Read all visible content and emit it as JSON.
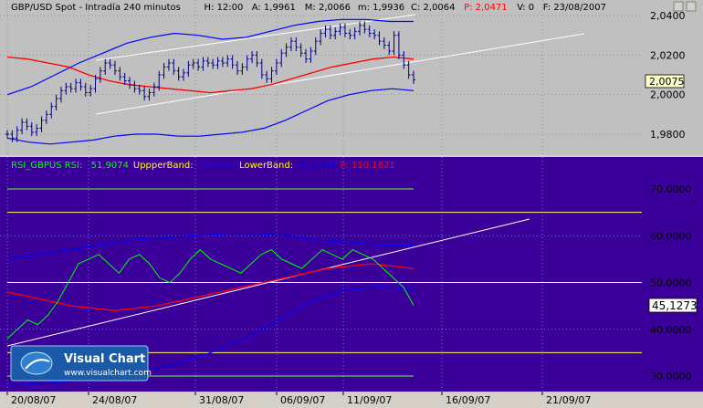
{
  "top_panel": {
    "header": [
      {
        "text": "GBP/USD Spot - Intradía 240 minutos",
        "color": "#000000"
      },
      {
        "text": "H: 12:00",
        "color": "#000000"
      },
      {
        "text": "A: 1,9961",
        "color": "#000000"
      },
      {
        "text": "M: 2,0066",
        "color": "#000000"
      },
      {
        "text": "m: 1,9936",
        "color": "#000000"
      },
      {
        "text": "C: 2,0064",
        "color": "#000000"
      },
      {
        "text": "P: 2,0471",
        "color": "#ff0000"
      },
      {
        "text": "V: 0",
        "color": "#000000"
      },
      {
        "text": "F: 23/08/2007",
        "color": "#000000"
      }
    ],
    "y_ticks": [
      "2,0400",
      "2,0200",
      "2,0000",
      "1,9800"
    ],
    "last_value_label": "2,0075",
    "colors": {
      "background": "#c0c0c0",
      "price_bars": "#000080",
      "moving_average": "#ff0000",
      "bands": "#0000ff",
      "trendlines": "#ffffff"
    }
  },
  "bottom_panel": {
    "header": [
      {
        "text": "RSI_GBPUS RSI:",
        "color": "#00ff00"
      },
      {
        "text": "51,9074",
        "color": "#00ff00"
      },
      {
        "text": "UppperBand:",
        "color": "#ffff00"
      },
      {
        "text": "70,0000",
        "color": "#0000ff"
      },
      {
        "text": "LowerBand:",
        "color": "#ffff00"
      },
      {
        "text": "30,0000",
        "color": "#0000ff"
      },
      {
        "text": "P: 110,1821",
        "color": "#ff0000"
      }
    ],
    "y_ticks": [
      "70,0000",
      "60,0000",
      "50,0000",
      "40,0000",
      "30,0000"
    ],
    "last_value_label": "45,1273",
    "colors": {
      "background": "#3a0099",
      "rsi": "#00ff00",
      "moving_average": "#ff0000",
      "bands": "#0000ff",
      "levels_green": "#66ff33",
      "levels_yellow": "#ffff66",
      "trendline": "#ffffff"
    }
  },
  "x_axis": {
    "labels": [
      "20/08/07",
      "24/08/07",
      "31/08/07",
      "06/09/07",
      "11/09/07",
      "16/09/07",
      "21/09/07"
    ]
  },
  "logo": {
    "name": "Visual Chart",
    "url": "www.visualchart.com"
  },
  "chart_data": [
    {
      "type": "candlestick",
      "title": "GBP/USD Spot - Intradía 240 minutos",
      "ylim": [
        1.97,
        2.042
      ],
      "series": [
        {
          "name": "GBP/USD",
          "values": [
            1.98,
            1.978,
            1.982,
            1.986,
            1.984,
            1.981,
            1.983,
            1.987,
            1.99,
            1.994,
            1.998,
            2.002,
            2.004,
            2.003,
            2.006,
            2.004,
            2.001,
            2.003,
            2.008,
            2.012,
            2.016,
            2.015,
            2.012,
            2.009,
            2.007,
            2.005,
            2.003,
            2.002,
            1.999,
            2.001,
            2.004,
            2.01,
            2.014,
            2.016,
            2.012,
            2.009,
            2.011,
            2.015,
            2.016,
            2.014,
            2.017,
            2.016,
            2.015,
            2.017,
            2.016,
            2.018,
            2.015,
            2.012,
            2.014,
            2.018,
            2.02,
            2.016,
            2.01,
            2.008,
            2.012,
            2.016,
            2.021,
            2.024,
            2.027,
            2.024,
            2.021,
            2.018,
            2.022,
            2.027,
            2.031,
            2.033,
            2.03,
            2.032,
            2.034,
            2.031,
            2.03,
            2.032,
            2.035,
            2.033,
            2.031,
            2.03,
            2.027,
            2.025,
            2.022,
            2.03,
            2.02,
            2.015,
            2.01,
            2.0075
          ]
        },
        {
          "name": "Moving average",
          "values": [
            2.019,
            2.018,
            2.016,
            2.014,
            2.01,
            2.007,
            2.005,
            2.004,
            2.003,
            2.002,
            2.001,
            2.002,
            2.003,
            2.005,
            2.008,
            2.011,
            2.014,
            2.016,
            2.018,
            2.019,
            2.018
          ]
        },
        {
          "name": "Upper band",
          "values": [
            2.0,
            2.004,
            2.01,
            2.016,
            2.021,
            2.026,
            2.029,
            2.031,
            2.03,
            2.028,
            2.029,
            2.032,
            2.035,
            2.037,
            2.038,
            2.038,
            2.037,
            2.037
          ]
        },
        {
          "name": "Lower band",
          "values": [
            1.978,
            1.976,
            1.975,
            1.976,
            1.977,
            1.979,
            1.98,
            1.98,
            1.979,
            1.979,
            1.98,
            1.981,
            1.983,
            1.987,
            1.992,
            1.997,
            2.0,
            2.002,
            2.003,
            2.002
          ]
        }
      ]
    },
    {
      "type": "line",
      "title": "RSI_GBPUS",
      "ylim": [
        26,
        75
      ],
      "bands": [
        70,
        65,
        50,
        35,
        30
      ],
      "series": [
        {
          "name": "RSI",
          "values": [
            38,
            40,
            42,
            41,
            43,
            46,
            50,
            54,
            55,
            56,
            54,
            52,
            55,
            56,
            54,
            51,
            50,
            52,
            55,
            57,
            55,
            54,
            53,
            52,
            54,
            56,
            57,
            55,
            54,
            53,
            55,
            57,
            56,
            55,
            57,
            56,
            55,
            53,
            51,
            49,
            45.1273
          ]
        },
        {
          "name": "Moving average",
          "values": [
            48,
            47,
            46,
            45,
            44.5,
            44,
            44.5,
            45,
            46,
            47,
            48,
            49,
            50,
            51,
            52,
            53,
            53.5,
            54,
            53.5,
            53
          ]
        },
        {
          "name": "Upper band",
          "values": [
            55,
            56,
            57,
            58,
            59,
            59.5,
            60,
            60.5,
            60.5,
            60,
            59,
            58.5,
            58,
            58
          ]
        },
        {
          "name": "Lower band",
          "values": [
            28,
            28.5,
            29,
            30,
            31,
            32.5,
            35,
            38,
            42,
            46,
            48.5,
            49,
            48.5
          ]
        }
      ]
    }
  ]
}
